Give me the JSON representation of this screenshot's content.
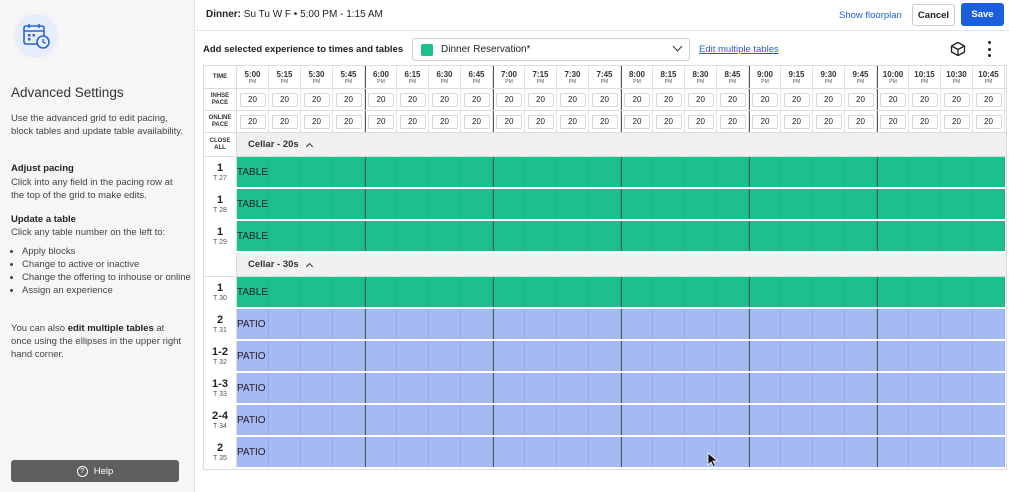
{
  "sidebar": {
    "icon": "calendar-clock-icon",
    "title": "Advanced Settings",
    "intro": "Use the advanced grid to edit pacing, block tables and update table availability.",
    "pacing_heading": "Adjust pacing",
    "pacing_text": "Click into any field in the pacing row at the top of the grid to make edits.",
    "table_heading": "Update a table",
    "table_text": "Click any table number on the left to:",
    "table_actions": [
      "Apply blocks",
      "Change to active or inactive",
      "Change the offering to inhouse or online",
      "Assign an experience"
    ],
    "multi_prefix": "You can also ",
    "multi_bold": "edit multiple tables",
    "multi_suffix": " at once using the ellipses in the upper right hand corner.",
    "help_label": "Help"
  },
  "header": {
    "service_label": "Dinner:",
    "service_value": "Su Tu W F • 5:00 PM - 1:15 AM",
    "show_floorplan": "Show floorplan",
    "cancel": "Cancel",
    "save": "Save"
  },
  "toolbar": {
    "add_label": "Add selected experience to times and tables",
    "experience_selected": "Dinner Reservation*",
    "experience_color": "#1cbf8e",
    "edit_multiple": "Edit multiple tables"
  },
  "grid": {
    "time_label": "TIME",
    "inhouse_label_1": "INHSE",
    "inhouse_label_2": "PACE",
    "online_label_1": "ONLINE",
    "online_label_2": "PACE",
    "close_label_1": "CLOSE",
    "close_label_2": "ALL",
    "times": [
      "5:00",
      "5:15",
      "5:30",
      "5:45",
      "6:00",
      "6:15",
      "6:30",
      "6:45",
      "7:00",
      "7:15",
      "7:30",
      "7:45",
      "8:00",
      "8:15",
      "8:30",
      "8:45",
      "9:00",
      "9:15",
      "9:30",
      "9:45",
      "10:00",
      "10:15",
      "10:30",
      "10:45"
    ],
    "ampm": "PM",
    "inhouse_pace": [
      20,
      20,
      20,
      20,
      20,
      20,
      20,
      20,
      20,
      20,
      20,
      20,
      20,
      20,
      20,
      20,
      20,
      20,
      20,
      20,
      20,
      20,
      20,
      20
    ],
    "online_pace": [
      20,
      20,
      20,
      20,
      20,
      20,
      20,
      20,
      20,
      20,
      20,
      20,
      20,
      20,
      20,
      20,
      20,
      20,
      20,
      20,
      20,
      20,
      20,
      20
    ],
    "sections": [
      {
        "name": "Cellar - 20s",
        "tables": [
          {
            "capacity": "1",
            "id": "T 27",
            "label": "TABLE",
            "color": "teal"
          },
          {
            "capacity": "1",
            "id": "T 28",
            "label": "TABLE",
            "color": "teal"
          },
          {
            "capacity": "1",
            "id": "T 29",
            "label": "TABLE",
            "color": "teal"
          }
        ]
      },
      {
        "name": "Cellar - 30s",
        "tables": [
          {
            "capacity": "1",
            "id": "T 30",
            "label": "TABLE",
            "color": "teal"
          },
          {
            "capacity": "2",
            "id": "T 31",
            "label": "PATIO",
            "color": "blue"
          },
          {
            "capacity": "1-2",
            "id": "T 32",
            "label": "PATIO",
            "color": "blue"
          },
          {
            "capacity": "1-3",
            "id": "T 33",
            "label": "PATIO",
            "color": "blue"
          },
          {
            "capacity": "2-4",
            "id": "T 34",
            "label": "PATIO",
            "color": "blue"
          },
          {
            "capacity": "2",
            "id": "T 35",
            "label": "PATIO",
            "color": "blue"
          }
        ]
      }
    ]
  }
}
